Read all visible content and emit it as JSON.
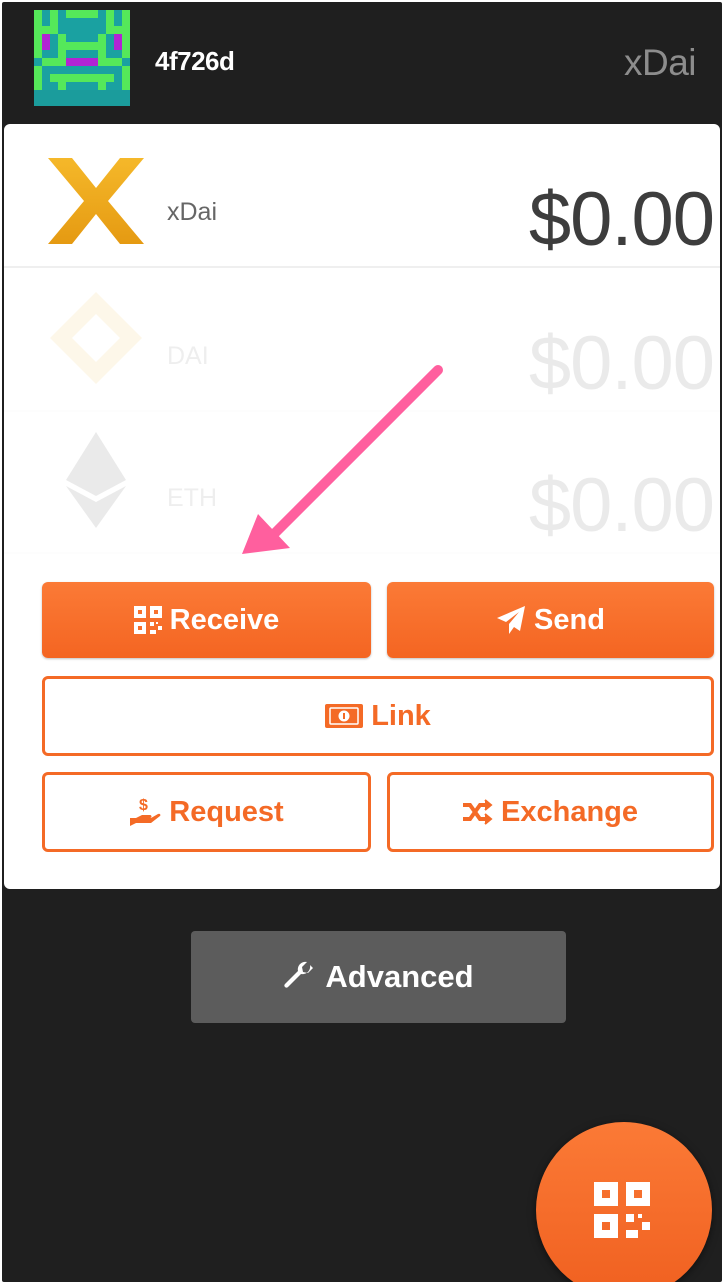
{
  "header": {
    "address": "4f726d",
    "network": "xDai"
  },
  "tokens": [
    {
      "name": "xDai",
      "balance": "$0.00",
      "icon": "xdai-logo-icon"
    },
    {
      "name": "DAI",
      "balance": "$0.00",
      "icon": "dai-logo-icon"
    },
    {
      "name": "ETH",
      "balance": "$0.00",
      "icon": "eth-logo-icon"
    }
  ],
  "actions": {
    "receive": "Receive",
    "send": "Send",
    "link": "Link",
    "request": "Request",
    "exchange": "Exchange",
    "advanced": "Advanced"
  },
  "colors": {
    "accent": "#f46a26",
    "background": "#1f1f1f",
    "annotation_arrow": "#ff5f9e"
  }
}
